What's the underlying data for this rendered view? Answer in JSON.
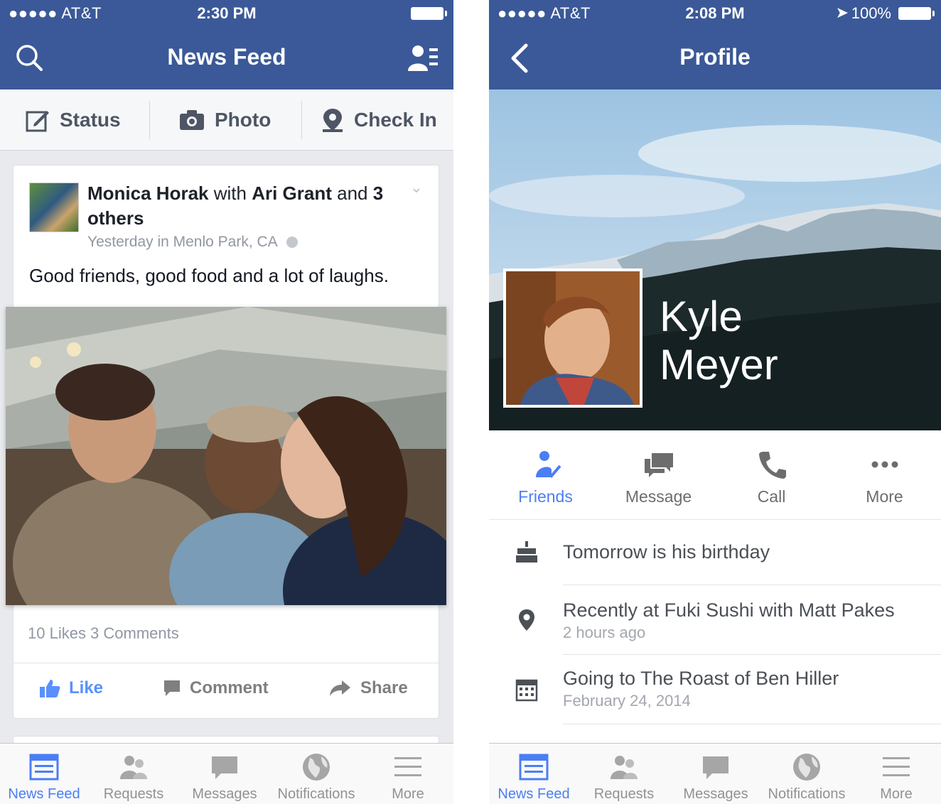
{
  "colors": {
    "brand": "#3b5998",
    "accent": "#4a7ef5",
    "muted": "#9197a3"
  },
  "left": {
    "status": {
      "carrier": "●●●●● AT&T",
      "time": "2:30 PM"
    },
    "nav": {
      "title": "News Feed",
      "left_icon": "search-icon",
      "right_icon": "friend-requests-icon"
    },
    "publisher": {
      "status": "Status",
      "photo": "Photo",
      "checkin": "Check In"
    },
    "story": {
      "author": "Monica Horak",
      "with_word": "with",
      "tagged": "Ari Grant",
      "and_word": "and",
      "others": "3 others",
      "meta": "Yesterday in Menlo Park, CA",
      "text": "Good friends, good food and a lot of laughs.",
      "counts": "10 Likes  3 Comments",
      "actions": {
        "like": "Like",
        "comment": "Comment",
        "share": "Share"
      }
    },
    "tabs": [
      "News Feed",
      "Requests",
      "Messages",
      "Notifications",
      "More"
    ]
  },
  "right": {
    "status": {
      "carrier": "●●●●● AT&T",
      "time": "2:08 PM",
      "battery": "100%"
    },
    "nav": {
      "title": "Profile",
      "left_icon": "back-chevron-icon"
    },
    "profile": {
      "first_name": "Kyle",
      "last_name": "Meyer"
    },
    "actions": {
      "friends": "Friends",
      "message": "Message",
      "call": "Call",
      "more": "More"
    },
    "info": {
      "birthday": "Tomorrow is his birthday",
      "checkin": "Recently at Fuki Sushi with Matt Pakes",
      "checkin_time": "2 hours ago",
      "event": "Going to The Roast of Ben Hiller",
      "event_date": "February 24, 2014"
    },
    "tabs": [
      "News Feed",
      "Requests",
      "Messages",
      "Notifications",
      "More"
    ]
  }
}
